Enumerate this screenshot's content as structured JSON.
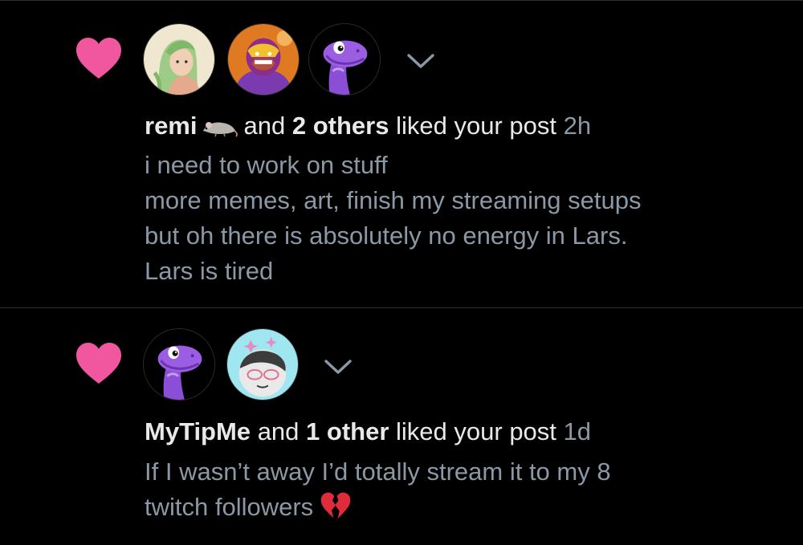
{
  "colors": {
    "background": "#000000",
    "heart": "#f0579f",
    "primary_text": "#e7e9ea",
    "secondary_text": "#8b98a5",
    "divider": "#2f3336"
  },
  "notifications": [
    {
      "icon": "heart-icon",
      "avatars": [
        "green-haired-girl-avatar",
        "luchador-avatar",
        "purple-dinosaur-avatar"
      ],
      "actor": "remi",
      "actor_emoji": "rat-emoji",
      "and_text": "and",
      "others_count": "2 others",
      "action": "liked your post",
      "time": "2h",
      "post_lines": [
        "i need to work on stuff",
        "more memes, art, finish my streaming setups",
        "but oh there is absolutely no energy in Lars.",
        "Lars is tired"
      ]
    },
    {
      "icon": "heart-icon",
      "avatars": [
        "purple-dinosaur-avatar",
        "sketch-character-avatar"
      ],
      "actor": "MyTipMe",
      "and_text": "and",
      "others_count": "1 other",
      "action": "liked your post",
      "time": "1d",
      "post_lines": [
        "If I wasn’t away I’d totally stream it to my 8",
        "twitch followers"
      ],
      "post_emoji": "broken-heart-emoji"
    }
  ]
}
